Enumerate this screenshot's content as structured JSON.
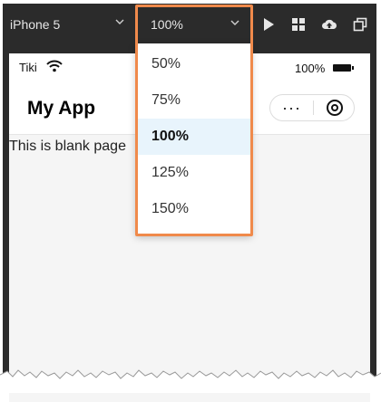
{
  "toolbar": {
    "device": "iPhone 5",
    "zoom": "100%",
    "icons": [
      "play-icon",
      "grid-icon",
      "cloud-upload-icon",
      "copy-window-icon"
    ]
  },
  "zoom_menu": {
    "options": [
      "50%",
      "75%",
      "100%",
      "125%",
      "150%"
    ],
    "selected": "100%"
  },
  "status_bar": {
    "carrier": "Tiki",
    "battery": "100%"
  },
  "nav": {
    "title": "My App",
    "more": "···"
  },
  "page": {
    "body_text": "This is blank page"
  },
  "colors": {
    "toolbar_bg": "#2b2b2b",
    "highlight": "#f08a4b",
    "selected_bg": "#e8f4fc"
  }
}
